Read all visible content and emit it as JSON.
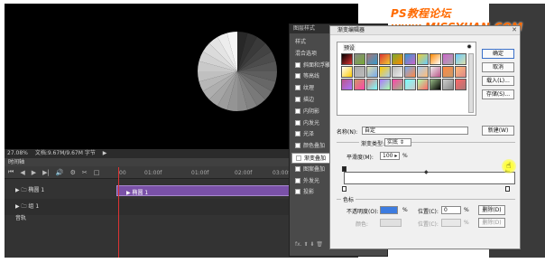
{
  "status_bar": {
    "zoom": "27.08%",
    "doc_info": "文档:9.67M/9.67M 字节"
  },
  "timeline": {
    "tab_label": "时间轴",
    "tools": [
      "⏮",
      "◀",
      "▶",
      "▶|",
      "🔊",
      "⚙",
      "✂",
      "□"
    ],
    "ruler": [
      "00",
      "01:00f",
      "01:00f",
      "02:00f",
      "03:00f"
    ],
    "rows": [
      {
        "label": "▶ 🗀 椭圆 1",
        "bar_label": "▶ 椭圆 1"
      },
      {
        "label": "▶ 🗀 组 1"
      },
      {
        "label": "音轨"
      }
    ]
  },
  "watermark": "PS教程论坛 www.MISSYUAN.COM",
  "right_strip": [
    "锁定",
    "",
    "",
    "",
    "",
    "",
    "",
    "",
    ""
  ],
  "layer_style": {
    "title": "图层样式",
    "items": [
      {
        "label": "样式",
        "checkbox": false,
        "selected": false
      },
      {
        "label": "混合选项",
        "checkbox": false,
        "selected": false
      },
      {
        "label": "斜面和浮雕",
        "checkbox": true,
        "selected": false
      },
      {
        "label": "等高线",
        "checkbox": true,
        "selected": false
      },
      {
        "label": "纹理",
        "checkbox": true,
        "selected": false
      },
      {
        "label": "描边",
        "checkbox": true,
        "selected": false
      },
      {
        "label": "内阴影",
        "checkbox": true,
        "selected": false
      },
      {
        "label": "内发光",
        "checkbox": true,
        "selected": false
      },
      {
        "label": "光泽",
        "checkbox": true,
        "selected": false
      },
      {
        "label": "颜色叠加",
        "checkbox": true,
        "selected": false
      },
      {
        "label": "渐变叠加",
        "checkbox": true,
        "selected": true
      },
      {
        "label": "图案叠加",
        "checkbox": true,
        "selected": false
      },
      {
        "label": "外发光",
        "checkbox": true,
        "selected": false
      },
      {
        "label": "投影",
        "checkbox": true,
        "selected": false
      }
    ],
    "footer": "fx. ⬆ ⬇ 🗑"
  },
  "gradient_editor": {
    "title": "渐变编辑器",
    "presets_label": "预设",
    "buttons": {
      "ok": "确定",
      "cancel": "取消",
      "load": "载入(L)...",
      "save": "存储(S)...",
      "new": "新建(W)"
    },
    "name_label": "名称(N):",
    "name_value": "自定",
    "type_label": "渐变类型:",
    "type_value": "实底",
    "smooth_label": "平滑度(M):",
    "smooth_value": "100",
    "smooth_unit": "%",
    "stops_label": "色标",
    "opacity_label": "不透明度(O):",
    "opacity_value": "",
    "opacity_unit": "%",
    "location_label": "位置(C):",
    "location_value": "0",
    "location_unit": "%",
    "delete_label": "删除(D)",
    "color_label": "颜色:",
    "color_location_label": "位置(C):",
    "color_unit": "%",
    "color_delete_label": "删除(D)"
  },
  "swatch_colors": [
    "#000",
    "#888",
    "#a77",
    "#d33",
    "#7a3",
    "#39c",
    "#ec3",
    "#f80",
    "#c6c",
    "#6cf",
    "#fff",
    "#aaa",
    "#dda",
    "#fc0",
    "#bbb",
    "#7ae",
    "#ace",
    "#eee",
    "#f84",
    "#fb7",
    "#b58",
    "#c96",
    "#d88",
    "#a7f",
    "#f4a",
    "#7ff",
    "#afa",
    "#9b8",
    "#ccc",
    "#f66"
  ]
}
